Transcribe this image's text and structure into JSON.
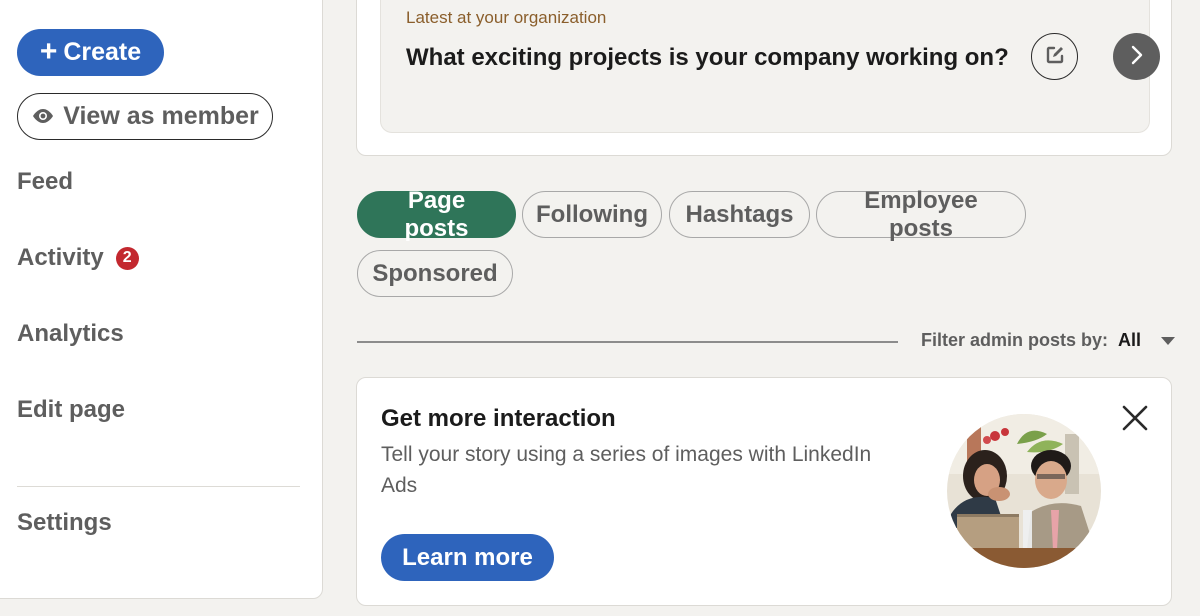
{
  "sidebar": {
    "create_label": "Create",
    "view_as_member_label": "View as member",
    "nav": {
      "feed": "Feed",
      "activity": "Activity",
      "activity_badge": "2",
      "analytics": "Analytics",
      "edit_page": "Edit page",
      "settings": "Settings"
    }
  },
  "latest": {
    "label": "Latest at your organization",
    "question": "What exciting projects is your company working on?",
    "icons": {
      "edit": "edit-icon",
      "next": "chevron-right-icon"
    }
  },
  "filters": {
    "pills": [
      {
        "label": "Page posts",
        "active": true
      },
      {
        "label": "Following",
        "active": false
      },
      {
        "label": "Hashtags",
        "active": false
      },
      {
        "label": "Employee posts",
        "active": false
      },
      {
        "label": "Sponsored",
        "active": false
      }
    ],
    "admin_filter_label": "Filter admin posts by:",
    "admin_filter_value": "All"
  },
  "promo": {
    "title": "Get more interaction",
    "description": "Tell your story using a series of images with LinkedIn Ads",
    "cta_label": "Learn more",
    "image_alt": "Two people laughing while looking at a laptop"
  },
  "colors": {
    "primary_blue": "#2e64bc",
    "active_green": "#2f7559",
    "badge_red": "#c3282f",
    "latest_label_brown": "#8a5e2b"
  }
}
